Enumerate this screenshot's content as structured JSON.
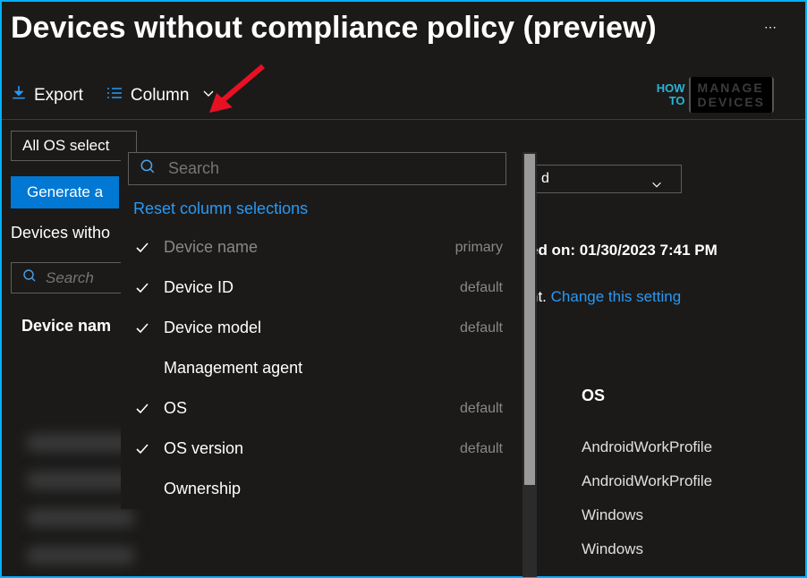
{
  "header": {
    "title": "Devices without compliance policy (preview)"
  },
  "toolbar": {
    "export_label": "Export",
    "column_label": "Column"
  },
  "filters": {
    "os_filter": "All OS select"
  },
  "generate_label": "Generate a",
  "section_label": "Devices witho",
  "search": {
    "placeholder": "Search"
  },
  "table": {
    "col_device_name": "Device nam",
    "col_os": "OS",
    "os_rows": [
      "AndroidWorkProfile",
      "AndroidWorkProfile",
      "Windows",
      "Windows"
    ]
  },
  "right_panel": {
    "extra_dropdown_trail": "d",
    "generated_text": "ed on: 01/30/2023 7:41 PM",
    "compliant_trail": "nt.",
    "change_setting_label": "Change this setting"
  },
  "column_dropdown": {
    "search_placeholder": "Search",
    "reset_label": "Reset column selections",
    "items": [
      {
        "label": "Device name",
        "checked": true,
        "tag": "primary",
        "disabled": true
      },
      {
        "label": "Device ID",
        "checked": true,
        "tag": "default",
        "disabled": false
      },
      {
        "label": "Device model",
        "checked": true,
        "tag": "default",
        "disabled": false
      },
      {
        "label": "Management agent",
        "checked": false,
        "tag": "",
        "disabled": false
      },
      {
        "label": "OS",
        "checked": true,
        "tag": "default",
        "disabled": false
      },
      {
        "label": "OS version",
        "checked": true,
        "tag": "default",
        "disabled": false
      },
      {
        "label": "Ownership",
        "checked": false,
        "tag": "",
        "disabled": false
      }
    ]
  },
  "logo": {
    "how": "HOW",
    "to": "TO",
    "manage": "MANAGE",
    "devices": "DEVICES"
  }
}
